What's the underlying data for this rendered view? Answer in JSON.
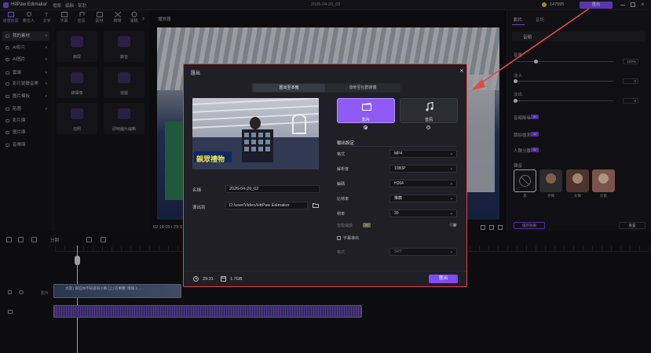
{
  "app": {
    "title": "HitPaw Edimakor",
    "menu": [
      "檔案",
      "編輯",
      "幫助"
    ],
    "project_date": "2026-04-20_02",
    "credits": "147995",
    "export_label": "匯出"
  },
  "toolbar": {
    "items": [
      "媒體資源",
      "數位人",
      "文字",
      "字幕",
      "音訊",
      "素材",
      "轉場",
      "濾鏡"
    ]
  },
  "left_panel": {
    "items": [
      "我的素材",
      "AI影片",
      "AI圖片",
      "雲端",
      "影片變聲音樂",
      "圖片模板",
      "貼圖",
      "影片庫",
      "圖片庫",
      "音樂庫"
    ]
  },
  "assets": {
    "tiles": [
      "錄屏",
      "錄音",
      "錄攝像",
      "遊戲",
      "拍照",
      "即時圖片編輯"
    ]
  },
  "preview": {
    "label": "播放器",
    "time": "02:18:05 / 29:3"
  },
  "right_panel": {
    "tabs": [
      "影片",
      "音訊"
    ],
    "section": "音頻",
    "volume_label": "音量",
    "volume_value": "100%",
    "fade_in_label": "淡入",
    "fade_in_value": "0",
    "fade_out_label": "淡出",
    "fade_out_value": "0",
    "denoise_label": "音頻降噪",
    "beat_label": "節拍檢測",
    "voice_label": "人聲分離",
    "voice_section": "聲音",
    "voices": [
      "無",
      "男聲",
      "女聲",
      "兒童"
    ],
    "reset_label": "重置",
    "save_label": "儲存效果",
    "ai_badge": "AI"
  },
  "timeline": {
    "split_label": "分割",
    "track_video_label": "影片",
    "clip_text": "大話 | 那些你不知道的小事 (上) 在事實: 情報 1 ..."
  },
  "dialog": {
    "title": "匯出",
    "tabs": [
      "匯出至本機",
      "發佈至社群媒體"
    ],
    "thumbnail_caption": "親眾禮物",
    "name_label": "名稱",
    "name_value": "2026-04-20_02",
    "export_to_label": "導出到",
    "export_path": "D:/user/Video/HitPaw Edimakor",
    "format_video": "影片",
    "format_audio": "音訊",
    "settings_title": "輸出設定",
    "settings": [
      {
        "label": "格式",
        "value": "MP4"
      },
      {
        "label": "解析度",
        "value": "1080P"
      },
      {
        "label": "編碼",
        "value": "H264"
      },
      {
        "label": "比特率",
        "value": "推薦"
      },
      {
        "label": "幀率",
        "value": "30"
      }
    ],
    "hdr_label": "智能縮放",
    "hdr_badge": "AI",
    "subtitle_label": "字幕導出",
    "subtitle_format_label": "格式",
    "subtitle_format_value": "SRT",
    "duration": "29:31",
    "size": "1.7GB",
    "export_button": "匯出"
  },
  "colors": {
    "accent": "#7d4cf2",
    "highlight_border": "#e0454b"
  }
}
